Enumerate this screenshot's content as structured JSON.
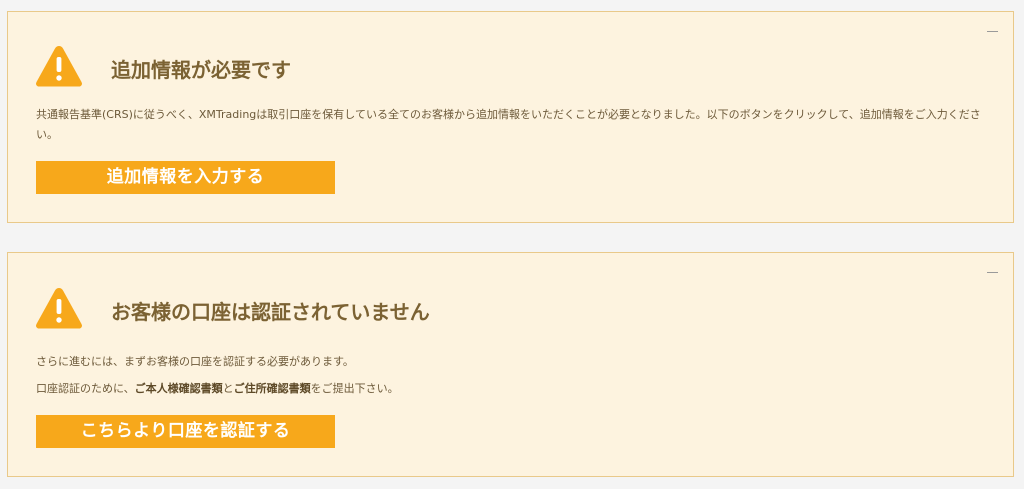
{
  "colors": {
    "panel_background": "#fdf3df",
    "panel_border": "#e9c98a",
    "accent_orange": "#f7a81b",
    "title_text": "#7b6233"
  },
  "alerts": [
    {
      "icon": "warning-triangle-icon",
      "title": "追加情報が必要です",
      "body_line": "共通報告基準(CRS)に従うべく、XMTradingは取引口座を保有している全てのお客様から追加情報をいただくことが必要となりました。以下のボタンをクリックして、追加情報をご入力ください。",
      "button_label": "追加情報を入力する"
    },
    {
      "icon": "warning-triangle-icon",
      "title": "お客様の口座は認証されていません",
      "line1": "さらに進むには、まずお客様の口座を認証する必要があります。",
      "line2_prefix": "口座認証のために、",
      "line2_bold1": "ご本人様確認書類",
      "line2_mid": "と",
      "line2_bold2": "ご住所確認書類",
      "line2_suffix": "をご提出下さい。",
      "button_label": "こちらより口座を認証する"
    }
  ]
}
